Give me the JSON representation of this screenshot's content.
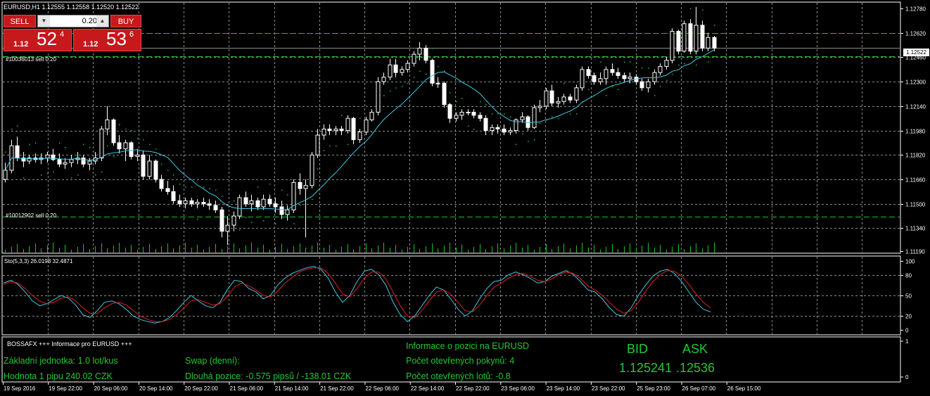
{
  "chart_header": {
    "symbol_tf": "EURUSD,H1",
    "ohlc": "1.12555 1.12558 1.12520 1.12522"
  },
  "trade_panel": {
    "sell_label": "SELL",
    "buy_label": "BUY",
    "lot_value": "0.20",
    "sell_price": {
      "base": "1.12",
      "big": "52",
      "sup": "4"
    },
    "buy_price": {
      "base": "1.12",
      "big": "53",
      "sup": "6"
    }
  },
  "orders": [
    {
      "label": "#10036013 sell 0.20",
      "price": 1.12468
    },
    {
      "label": "#10012902 sell 0.20",
      "price": 1.11418
    }
  ],
  "current_price": "1.12522",
  "hlines": [
    1.1262,
    1.12522
  ],
  "price_axis": {
    "min": 1.1119,
    "max": 1.1278,
    "ticks": [
      "1.12780",
      "1.12620",
      "1.12460",
      "1.12300",
      "1.12140",
      "1.11980",
      "1.11820",
      "1.11660",
      "1.11500",
      "1.11340",
      "1.11190"
    ]
  },
  "stoch": {
    "title": "Sto(5,3,3) 26.0198 32.4871",
    "ticks": [
      "100",
      "80",
      "50",
      "20",
      "0"
    ],
    "levels": [
      80,
      20
    ],
    "main": [
      68,
      72,
      66,
      55,
      42,
      35,
      38,
      44,
      50,
      46,
      36,
      22,
      18,
      28,
      40,
      42,
      38,
      30,
      20,
      15,
      12,
      10,
      12,
      18,
      28,
      40,
      50,
      42,
      35,
      32,
      40,
      58,
      72,
      70,
      60,
      55,
      45,
      50,
      65,
      75,
      82,
      86,
      90,
      92,
      88,
      75,
      55,
      40,
      50,
      70,
      85,
      88,
      80,
      65,
      40,
      22,
      12,
      20,
      35,
      50,
      62,
      58,
      45,
      30,
      20,
      28,
      45,
      60,
      70,
      72,
      80,
      84,
      80,
      75,
      68,
      70,
      78,
      82,
      86,
      80,
      70,
      58,
      55,
      45,
      32,
      22,
      20,
      32,
      50,
      65,
      78,
      85,
      88,
      82,
      70,
      55,
      40,
      30,
      26
    ],
    "signal": [
      66,
      70,
      68,
      60,
      50,
      42,
      38,
      40,
      46,
      48,
      42,
      32,
      24,
      24,
      32,
      38,
      40,
      36,
      28,
      20,
      15,
      12,
      12,
      15,
      22,
      32,
      42,
      44,
      40,
      36,
      38,
      48,
      62,
      68,
      64,
      58,
      50,
      48,
      56,
      68,
      76,
      84,
      88,
      90,
      90,
      82,
      68,
      52,
      48,
      60,
      75,
      84,
      84,
      74,
      55,
      35,
      20,
      18,
      28,
      42,
      55,
      58,
      52,
      40,
      28,
      26,
      36,
      50,
      62,
      68,
      75,
      80,
      82,
      78,
      72,
      70,
      74,
      80,
      84,
      82,
      74,
      64,
      58,
      50,
      40,
      30,
      24,
      28,
      40,
      56,
      70,
      80,
      86,
      85,
      78,
      66,
      52,
      40,
      32
    ]
  },
  "info_panel": {
    "header": "BOSSAFX +++ Informace pro EURUSD +++",
    "base_unit": "Základní jednotka: 1.0  lot/kus",
    "pip_value": "Hodnota 1 pipu 240.02 CZK",
    "swap_label": "Swap (denní):",
    "swap_long": "Dlouhá pozice:   -0.575 pipsů /   -138.01 CZK",
    "position_info": "Informace o pozici na EURUSD",
    "open_orders": "Počet otevřených pokynů: 4",
    "open_lots": "Počet otevřených lotů: -0.8",
    "bid_label": "BID",
    "ask_label": "ASK",
    "bid_value": "1.125241",
    "ask_value": ".12536"
  },
  "info_axis": {
    "ticks": [
      "1",
      "0"
    ]
  },
  "time_axis": [
    "19 Sep 2016",
    "19 Sep 22:00",
    "20 Sep 06:00",
    "20 Sep 14:00",
    "20 Sep 22:00",
    "21 Sep 06:00",
    "21 Sep 14:00",
    "21 Sep 22:00",
    "22 Sep 06:00",
    "22 Sep 14:00",
    "22 Sep 22:00",
    "23 Sep 06:00",
    "23 Sep 14:00",
    "23 Sep 22:00",
    "25 Sep 23:00",
    "26 Sep 07:00",
    "26 Sep 15:00"
  ],
  "candles": [
    [
      1.1166,
      1.1177,
      1.1164,
      1.1172
    ],
    [
      1.1172,
      1.1192,
      1.117,
      1.1188
    ],
    [
      1.1188,
      1.1194,
      1.1178,
      1.118
    ],
    [
      1.118,
      1.1184,
      1.1174,
      1.1178
    ],
    [
      1.1178,
      1.1182,
      1.1176,
      1.118
    ],
    [
      1.118,
      1.1183,
      1.1177,
      1.1179
    ],
    [
      1.1179,
      1.1183,
      1.1176,
      1.118
    ],
    [
      1.118,
      1.1184,
      1.1177,
      1.1182
    ],
    [
      1.1182,
      1.1186,
      1.1178,
      1.1179
    ],
    [
      1.1179,
      1.1183,
      1.1174,
      1.1176
    ],
    [
      1.1176,
      1.118,
      1.1173,
      1.1177
    ],
    [
      1.1177,
      1.1182,
      1.1174,
      1.1179
    ],
    [
      1.1179,
      1.1184,
      1.1176,
      1.118
    ],
    [
      1.118,
      1.1182,
      1.1174,
      1.1176
    ],
    [
      1.1176,
      1.118,
      1.1172,
      1.1178
    ],
    [
      1.1178,
      1.1184,
      1.1176,
      1.118
    ],
    [
      1.118,
      1.1201,
      1.1178,
      1.1199
    ],
    [
      1.1199,
      1.1214,
      1.1195,
      1.1205
    ],
    [
      1.1205,
      1.1206,
      1.1188,
      1.119
    ],
    [
      1.119,
      1.1195,
      1.1183,
      1.1186
    ],
    [
      1.1186,
      1.1192,
      1.1178,
      1.119
    ],
    [
      1.119,
      1.1191,
      1.1179,
      1.1181
    ],
    [
      1.1181,
      1.1186,
      1.1178,
      1.1182
    ],
    [
      1.1182,
      1.1185,
      1.1166,
      1.1168
    ],
    [
      1.1168,
      1.1182,
      1.1166,
      1.1178
    ],
    [
      1.1178,
      1.1179,
      1.1164,
      1.1166
    ],
    [
      1.1166,
      1.1169,
      1.1158,
      1.116
    ],
    [
      1.116,
      1.1165,
      1.1156,
      1.1158
    ],
    [
      1.1158,
      1.1162,
      1.115,
      1.1152
    ],
    [
      1.1152,
      1.1156,
      1.1148,
      1.115
    ],
    [
      1.115,
      1.1154,
      1.1147,
      1.1152
    ],
    [
      1.1152,
      1.1154,
      1.1148,
      1.115
    ],
    [
      1.115,
      1.1153,
      1.1147,
      1.1151
    ],
    [
      1.1151,
      1.1154,
      1.1148,
      1.115
    ],
    [
      1.115,
      1.1153,
      1.1146,
      1.1149
    ],
    [
      1.1149,
      1.1152,
      1.1144,
      1.1146
    ],
    [
      1.1146,
      1.1148,
      1.1128,
      1.1132
    ],
    [
      1.1132,
      1.1142,
      1.1123,
      1.1136
    ],
    [
      1.1136,
      1.1145,
      1.1132,
      1.1142
    ],
    [
      1.1142,
      1.1156,
      1.114,
      1.1154
    ],
    [
      1.1154,
      1.1158,
      1.1148,
      1.115
    ],
    [
      1.115,
      1.1156,
      1.1145,
      1.1152
    ],
    [
      1.1152,
      1.1154,
      1.1146,
      1.1148
    ],
    [
      1.1148,
      1.1156,
      1.1146,
      1.1153
    ],
    [
      1.1153,
      1.1156,
      1.1148,
      1.115
    ],
    [
      1.115,
      1.1154,
      1.1144,
      1.1148
    ],
    [
      1.1148,
      1.1152,
      1.114,
      1.1143
    ],
    [
      1.1143,
      1.1149,
      1.1139,
      1.1146
    ],
    [
      1.1146,
      1.1166,
      1.1144,
      1.1164
    ],
    [
      1.1164,
      1.117,
      1.1156,
      1.116
    ],
    [
      1.116,
      1.1166,
      1.1128,
      1.1162
    ],
    [
      1.1162,
      1.1184,
      1.116,
      1.1182
    ],
    [
      1.1182,
      1.1199,
      1.118,
      1.1195
    ],
    [
      1.1195,
      1.1202,
      1.1192,
      1.1199
    ],
    [
      1.1199,
      1.1202,
      1.1195,
      1.1198
    ],
    [
      1.1198,
      1.1201,
      1.1195,
      1.1199
    ],
    [
      1.1199,
      1.1201,
      1.1195,
      1.1198
    ],
    [
      1.1198,
      1.1208,
      1.1196,
      1.1206
    ],
    [
      1.1206,
      1.1207,
      1.1189,
      1.1192
    ],
    [
      1.1192,
      1.1199,
      1.119,
      1.1197
    ],
    [
      1.1197,
      1.1207,
      1.1195,
      1.1205
    ],
    [
      1.1205,
      1.1212,
      1.1204,
      1.121
    ],
    [
      1.121,
      1.1233,
      1.1208,
      1.123
    ],
    [
      1.123,
      1.1236,
      1.1228,
      1.1233
    ],
    [
      1.1233,
      1.1245,
      1.1231,
      1.1241
    ],
    [
      1.1241,
      1.1245,
      1.1233,
      1.1236
    ],
    [
      1.1236,
      1.124,
      1.1234,
      1.1238
    ],
    [
      1.1238,
      1.1244,
      1.1236,
      1.1242
    ],
    [
      1.1242,
      1.125,
      1.124,
      1.1248
    ],
    [
      1.1248,
      1.1256,
      1.1244,
      1.1252
    ],
    [
      1.1252,
      1.1254,
      1.1242,
      1.1244
    ],
    [
      1.1244,
      1.1245,
      1.1227,
      1.1229
    ],
    [
      1.1229,
      1.1233,
      1.1226,
      1.1229
    ],
    [
      1.1229,
      1.123,
      1.1213,
      1.1215
    ],
    [
      1.1215,
      1.1216,
      1.1203,
      1.1206
    ],
    [
      1.1206,
      1.121,
      1.1204,
      1.1208
    ],
    [
      1.1208,
      1.1212,
      1.1205,
      1.121
    ],
    [
      1.121,
      1.1212,
      1.1208,
      1.121
    ],
    [
      1.121,
      1.1212,
      1.1206,
      1.1208
    ],
    [
      1.1208,
      1.121,
      1.1204,
      1.1206
    ],
    [
      1.1206,
      1.1208,
      1.1195,
      1.1198
    ],
    [
      1.1198,
      1.1202,
      1.1195,
      1.12
    ],
    [
      1.12,
      1.1202,
      1.1196,
      1.1199
    ],
    [
      1.1199,
      1.1202,
      1.1195,
      1.1197
    ],
    [
      1.1197,
      1.12,
      1.1195,
      1.1198
    ],
    [
      1.1198,
      1.1206,
      1.1196,
      1.1205
    ],
    [
      1.1205,
      1.121,
      1.1203,
      1.1207
    ],
    [
      1.1207,
      1.1208,
      1.1198,
      1.12
    ],
    [
      1.12,
      1.1215,
      1.1199,
      1.1213
    ],
    [
      1.1213,
      1.1218,
      1.121,
      1.1214
    ],
    [
      1.1214,
      1.1226,
      1.1212,
      1.1224
    ],
    [
      1.1224,
      1.1228,
      1.1214,
      1.1216
    ],
    [
      1.1216,
      1.122,
      1.1213,
      1.1217
    ],
    [
      1.1217,
      1.1222,
      1.1215,
      1.122
    ],
    [
      1.122,
      1.1222,
      1.1216,
      1.1218
    ],
    [
      1.1218,
      1.1228,
      1.1216,
      1.1226
    ],
    [
      1.1226,
      1.124,
      1.1224,
      1.1238
    ],
    [
      1.1238,
      1.124,
      1.1232,
      1.1234
    ],
    [
      1.1234,
      1.1236,
      1.1228,
      1.123
    ],
    [
      1.123,
      1.1236,
      1.1228,
      1.1232
    ],
    [
      1.1232,
      1.124,
      1.1228,
      1.1238
    ],
    [
      1.1238,
      1.1242,
      1.1234,
      1.1236
    ],
    [
      1.1236,
      1.1239,
      1.1232,
      1.1234
    ],
    [
      1.1234,
      1.1236,
      1.123,
      1.1232
    ],
    [
      1.1232,
      1.1236,
      1.1229,
      1.1233
    ],
    [
      1.1233,
      1.1235,
      1.1228,
      1.123
    ],
    [
      1.123,
      1.1232,
      1.1224,
      1.1226
    ],
    [
      1.1226,
      1.1232,
      1.1223,
      1.123
    ],
    [
      1.123,
      1.1238,
      1.1228,
      1.1236
    ],
    [
      1.1236,
      1.1242,
      1.1234,
      1.124
    ],
    [
      1.124,
      1.1246,
      1.1238,
      1.1244
    ],
    [
      1.1244,
      1.1265,
      1.1242,
      1.1263
    ],
    [
      1.1263,
      1.1264,
      1.1248,
      1.125
    ],
    [
      1.125,
      1.127,
      1.1249,
      1.1268
    ],
    [
      1.1268,
      1.1271,
      1.1248,
      1.125
    ],
    [
      1.125,
      1.1279,
      1.1248,
      1.1267
    ],
    [
      1.1267,
      1.127,
      1.125,
      1.1252
    ],
    [
      1.1252,
      1.1262,
      1.125,
      1.1259
    ],
    [
      1.1259,
      1.126,
      1.125,
      1.1252
    ]
  ]
}
